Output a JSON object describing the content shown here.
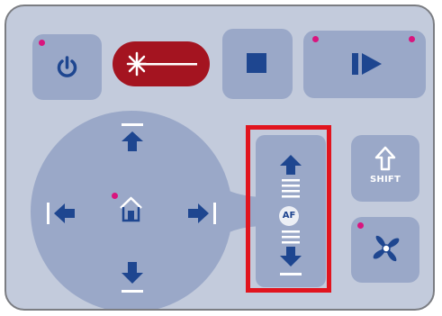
{
  "panel": {
    "background": "#c3cbdc",
    "button_color": "#9aa8c8",
    "icon_color": "#1e4690",
    "indicator_color": "#d9157e"
  },
  "buttons": {
    "power": {
      "icon": "power-icon"
    },
    "laser": {
      "icon": "laser-icon",
      "color": "#a41420"
    },
    "stop": {
      "icon": "stop-icon"
    },
    "play": {
      "icon": "play-pause-icon"
    },
    "shift": {
      "label": "SHIFT",
      "icon": "shift-arrow-icon"
    },
    "fan": {
      "icon": "fan-icon"
    },
    "af": {
      "label": "AF"
    },
    "dpad": {
      "up": "arrow-up-icon",
      "down": "arrow-down-icon",
      "left": "arrow-left-icon",
      "right": "arrow-right-icon",
      "home": "home-icon"
    }
  },
  "highlight": {
    "color": "#e1141e"
  }
}
